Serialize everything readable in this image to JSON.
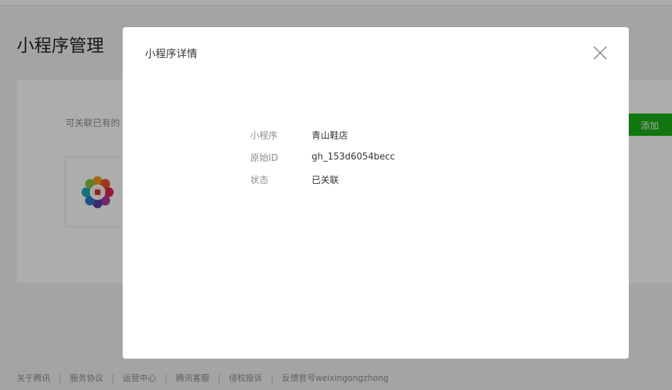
{
  "page": {
    "title": "小程序管理"
  },
  "card": {
    "intro": "可关联已有的",
    "add_label": "添加"
  },
  "footer": {
    "links": [
      "关于腾讯",
      "服务协议",
      "运营中心",
      "腾讯客服",
      "侵权投诉",
      "反馈官号weixingongzhong"
    ]
  },
  "dialog": {
    "title": "小程序详情",
    "close_icon": "close-icon",
    "rows": [
      {
        "label": "小程序",
        "value": "青山鞋店"
      },
      {
        "label": "原始ID",
        "value": "gh_153d6054becc"
      },
      {
        "label": "状态",
        "value": "已关联"
      }
    ]
  },
  "colors": {
    "accent": "#1aad19",
    "overlay": "rgba(0,0,0,0.32)"
  }
}
